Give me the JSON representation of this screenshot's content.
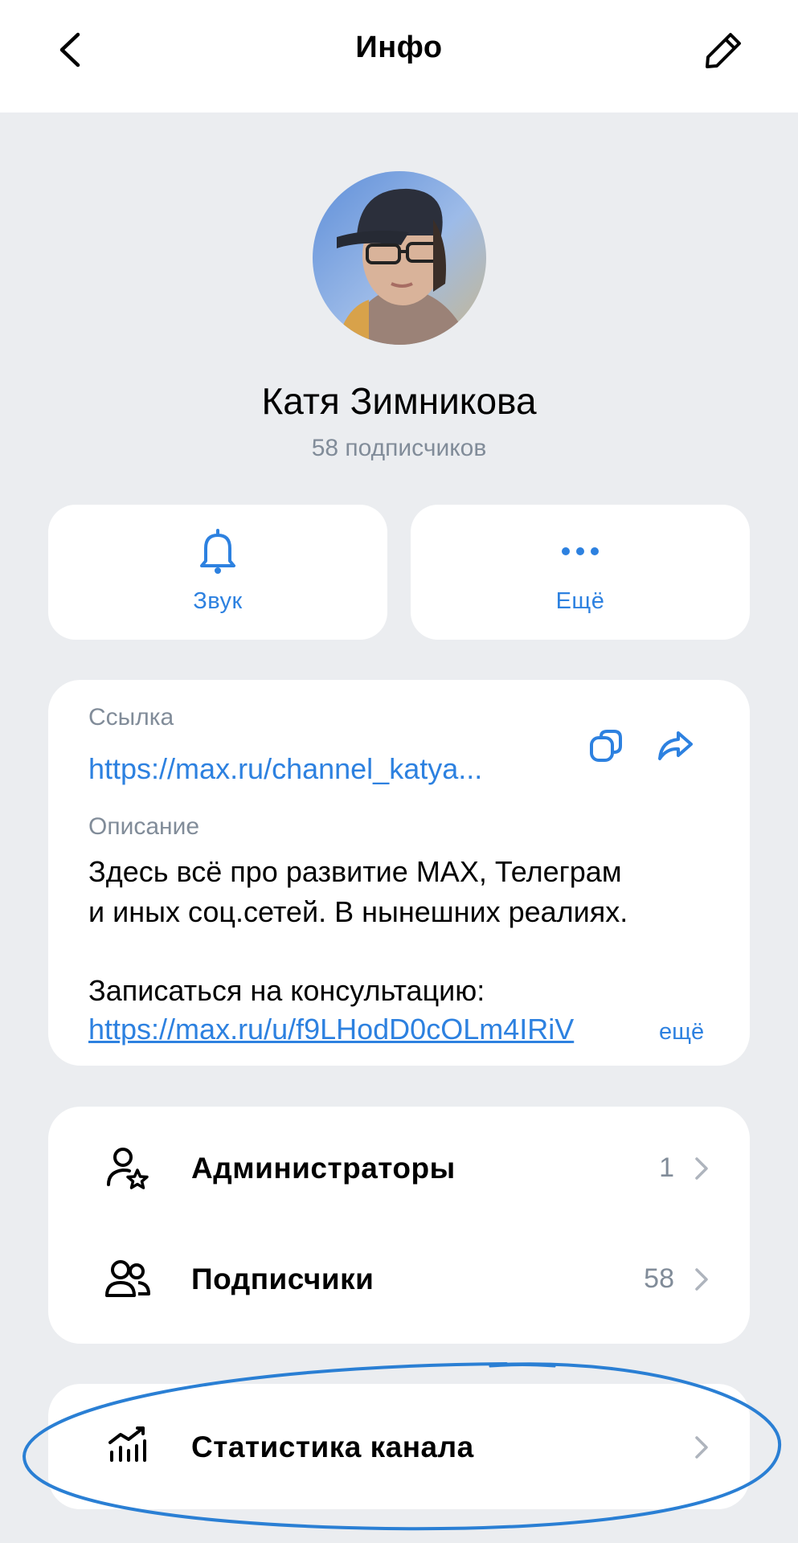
{
  "header": {
    "title": "Инфо",
    "back_icon": "chevron-left-icon",
    "edit_icon": "pencil-icon"
  },
  "profile": {
    "name": "Катя Зимникова",
    "subscribers": "58 подписчиков"
  },
  "actions": [
    {
      "label": "Звук",
      "icon": "bell-icon"
    },
    {
      "label": "Ещё",
      "icon": "more-dots-icon"
    }
  ],
  "info": {
    "link_label": "Ссылка",
    "link_value": "https://max.ru/channel_katya...",
    "description_label": "Описание",
    "description_lines": [
      "Здесь всё про развитие MAX, Телеграм",
      "и иных соц.сетей. В нынешних реалиях.",
      "Записаться на консультацию:"
    ],
    "description_link": "https://max.ru/u/f9LHodD0cOLm4IRiV",
    "more_label": "ещё"
  },
  "list": [
    {
      "label": "Администраторы",
      "count": "1",
      "icon": "admin-star-icon"
    },
    {
      "label": "Подписчики",
      "count": "58",
      "icon": "users-icon"
    }
  ],
  "stats": {
    "label": "Статистика канала",
    "icon": "chart-icon"
  },
  "colors": {
    "accent": "#2d81e0",
    "background": "#ebedf0",
    "secondary_text": "#818c99",
    "annotation": "#2a7fd4"
  }
}
